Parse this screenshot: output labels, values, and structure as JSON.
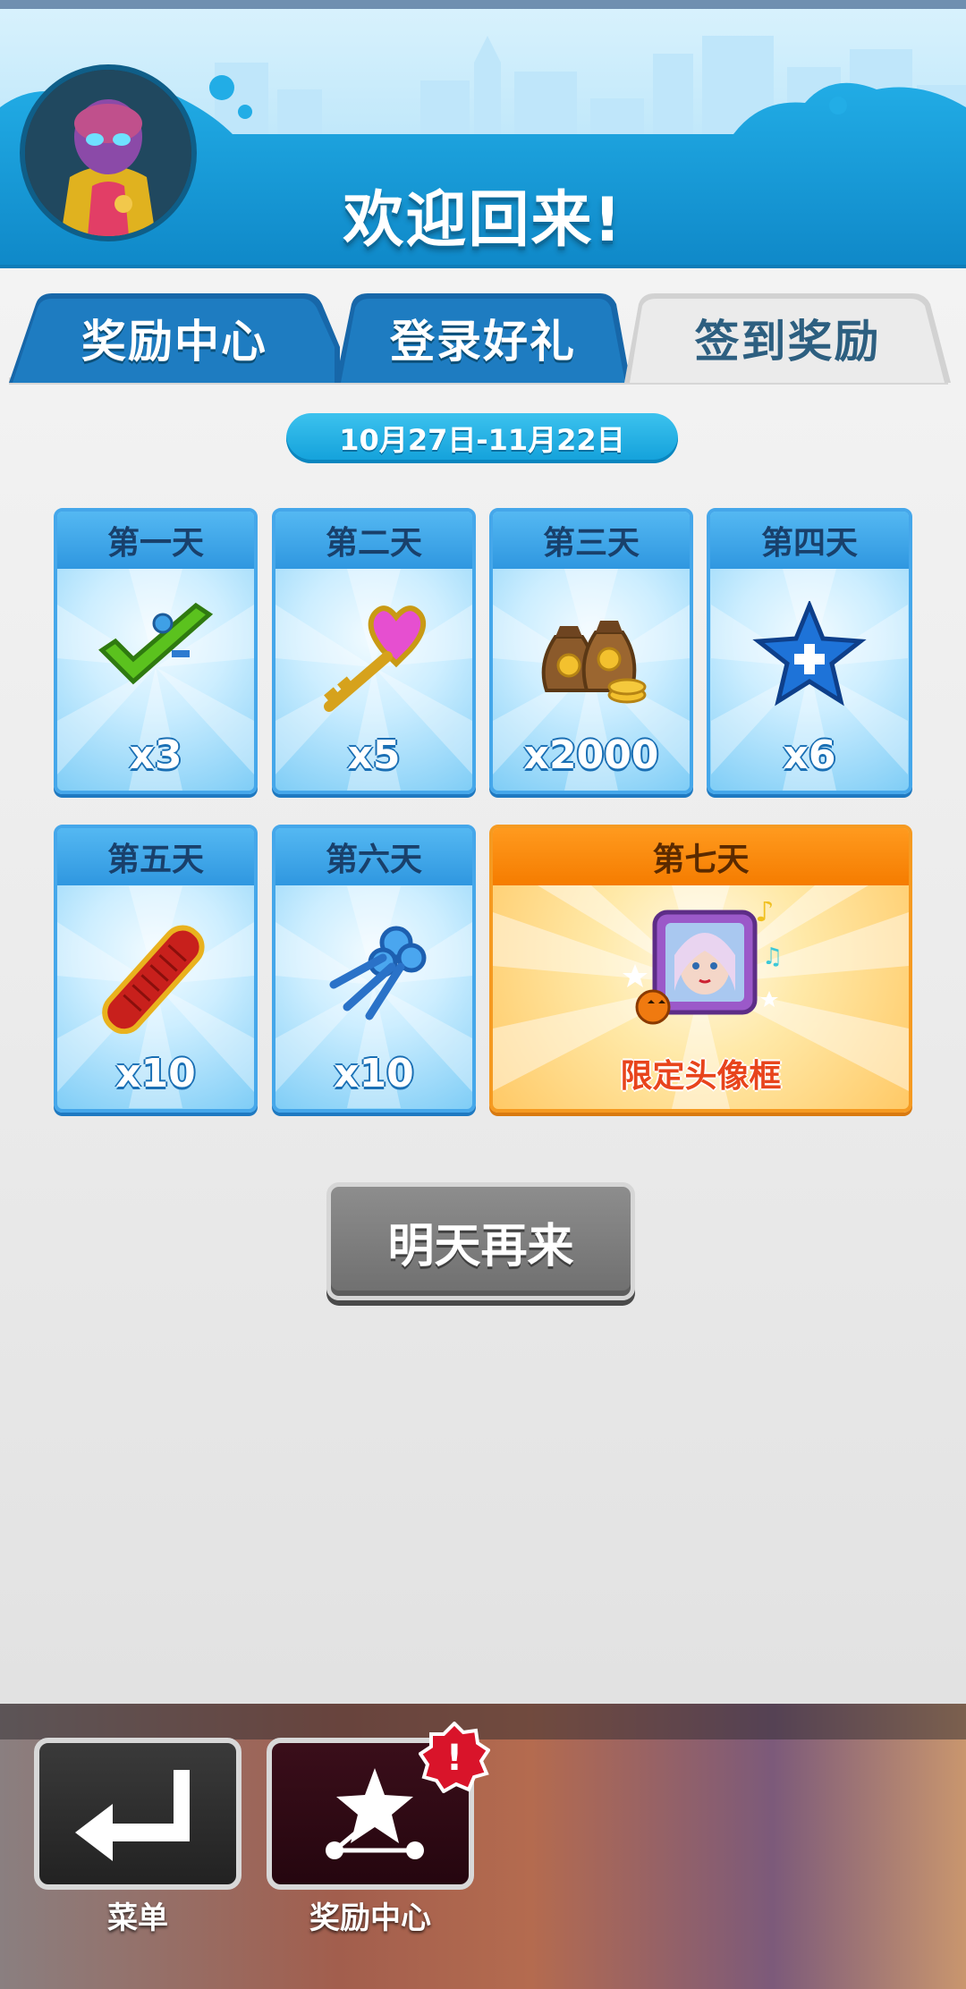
{
  "header": {
    "welcome": "欢迎回来!"
  },
  "tabs": [
    {
      "label": "奖励中心",
      "active": false
    },
    {
      "label": "登录好礼",
      "active": false
    },
    {
      "label": "签到奖励",
      "active": true
    }
  ],
  "date_range": "10月27日-11月22日",
  "days": [
    {
      "title": "第一天",
      "qty": "x3",
      "icon": "hoverboard-check-icon"
    },
    {
      "title": "第二天",
      "qty": "x5",
      "icon": "heart-key-icon"
    },
    {
      "title": "第三天",
      "qty": "x2000",
      "icon": "coin-bags-icon"
    },
    {
      "title": "第四天",
      "qty": "x6",
      "icon": "star-plus-icon"
    },
    {
      "title": "第五天",
      "qty": "x10",
      "icon": "red-skateboard-icon"
    },
    {
      "title": "第六天",
      "qty": "x10",
      "icon": "blue-keys-icon"
    },
    {
      "title": "第七天",
      "qty": "限定头像框",
      "icon": "avatar-frame-icon"
    }
  ],
  "button": {
    "label": "明天再来"
  },
  "bottom_nav": {
    "menu_label": "菜单",
    "reward_label": "奖励中心",
    "alert": "!"
  },
  "colors": {
    "header_blue": "#1b9cd8",
    "card_border": "#45a7ea",
    "gold_border": "#f59a21",
    "button_gray": "#7d7d7d",
    "alert_red": "#d9142a"
  }
}
